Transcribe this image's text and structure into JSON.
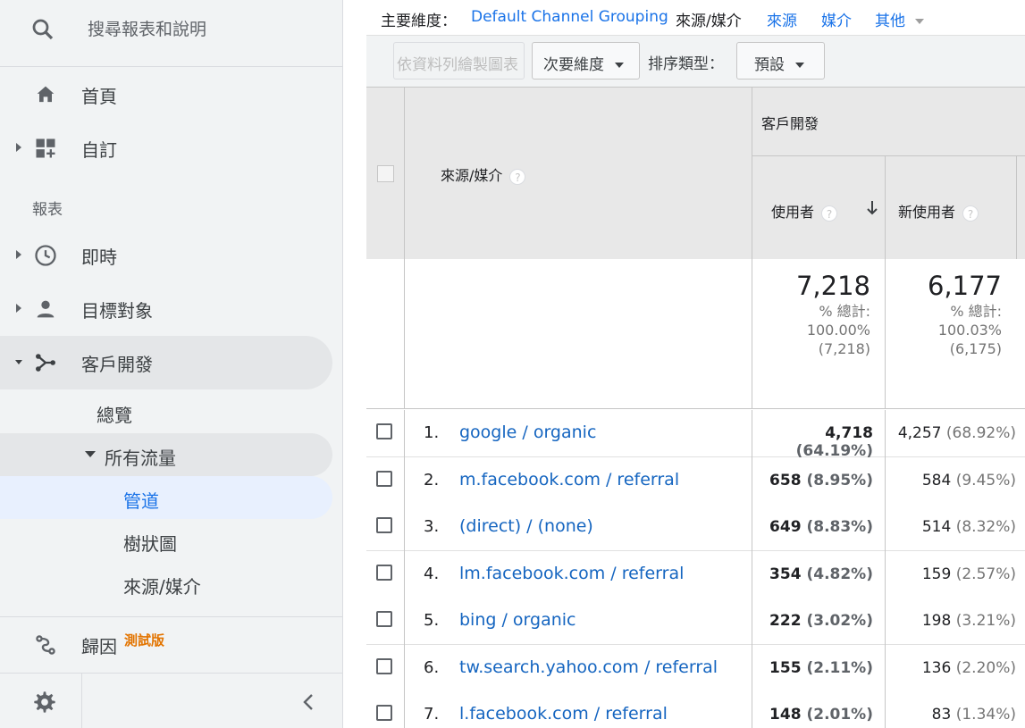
{
  "sidebar": {
    "search_placeholder": "搜尋報表和說明",
    "home": "首頁",
    "customize": "自訂",
    "reports_section": "報表",
    "realtime": "即時",
    "audience": "目標對象",
    "acquisition": "客戶開發",
    "overview": "總覽",
    "all_traffic": "所有流量",
    "channels": "管道",
    "treemaps": "樹狀圖",
    "source_medium": "來源/媒介",
    "attribution": "歸因",
    "beta_badge": "測試版"
  },
  "dimensions": {
    "label": "主要維度：",
    "default_channel_grouping": "Default Channel Grouping",
    "source_medium": "來源/媒介",
    "source": "來源",
    "medium": "媒介",
    "other": "其他"
  },
  "toolbar": {
    "plot_rows": "依資料列繪製圖表",
    "secondary_dimension": "次要維度",
    "sort_type_label": "排序類型：",
    "sort_default": "預設"
  },
  "table": {
    "dimension_header": "來源/媒介",
    "group_header": "客戶開發",
    "users_header": "使用者",
    "new_users_header": "新使用者",
    "totals": {
      "users": "7,218",
      "users_pct_label": "% 總計:",
      "users_pct": "100.00%",
      "users_of": "(7,218)",
      "new_users": "6,177",
      "new_users_pct_label": "% 總計:",
      "new_users_pct": "100.03%",
      "new_users_of": "(6,175)"
    },
    "rows": [
      {
        "num": "1.",
        "source": "google / organic",
        "users": "4,718",
        "users_pct": "(64.19%)",
        "new_users": "4,257",
        "new_users_pct": "(68.92%)"
      },
      {
        "num": "2.",
        "source": "m.facebook.com / referral",
        "users": "658",
        "users_pct": "(8.95%)",
        "new_users": "584",
        "new_users_pct": "(9.45%)"
      },
      {
        "num": "3.",
        "source": "(direct) / (none)",
        "users": "649",
        "users_pct": "(8.83%)",
        "new_users": "514",
        "new_users_pct": "(8.32%)"
      },
      {
        "num": "4.",
        "source": "lm.facebook.com / referral",
        "users": "354",
        "users_pct": "(4.82%)",
        "new_users": "159",
        "new_users_pct": "(2.57%)"
      },
      {
        "num": "5.",
        "source": "bing / organic",
        "users": "222",
        "users_pct": "(3.02%)",
        "new_users": "198",
        "new_users_pct": "(3.21%)"
      },
      {
        "num": "6.",
        "source": "tw.search.yahoo.com / referral",
        "users": "155",
        "users_pct": "(2.11%)",
        "new_users": "136",
        "new_users_pct": "(2.20%)"
      },
      {
        "num": "7.",
        "source": "l.facebook.com / referral",
        "users": "148",
        "users_pct": "(2.01%)",
        "new_users": "83",
        "new_users_pct": "(1.34%)"
      }
    ]
  },
  "colors": {
    "link": "#1565c0",
    "accent": "#1a73e8",
    "beta": "#e37400"
  }
}
